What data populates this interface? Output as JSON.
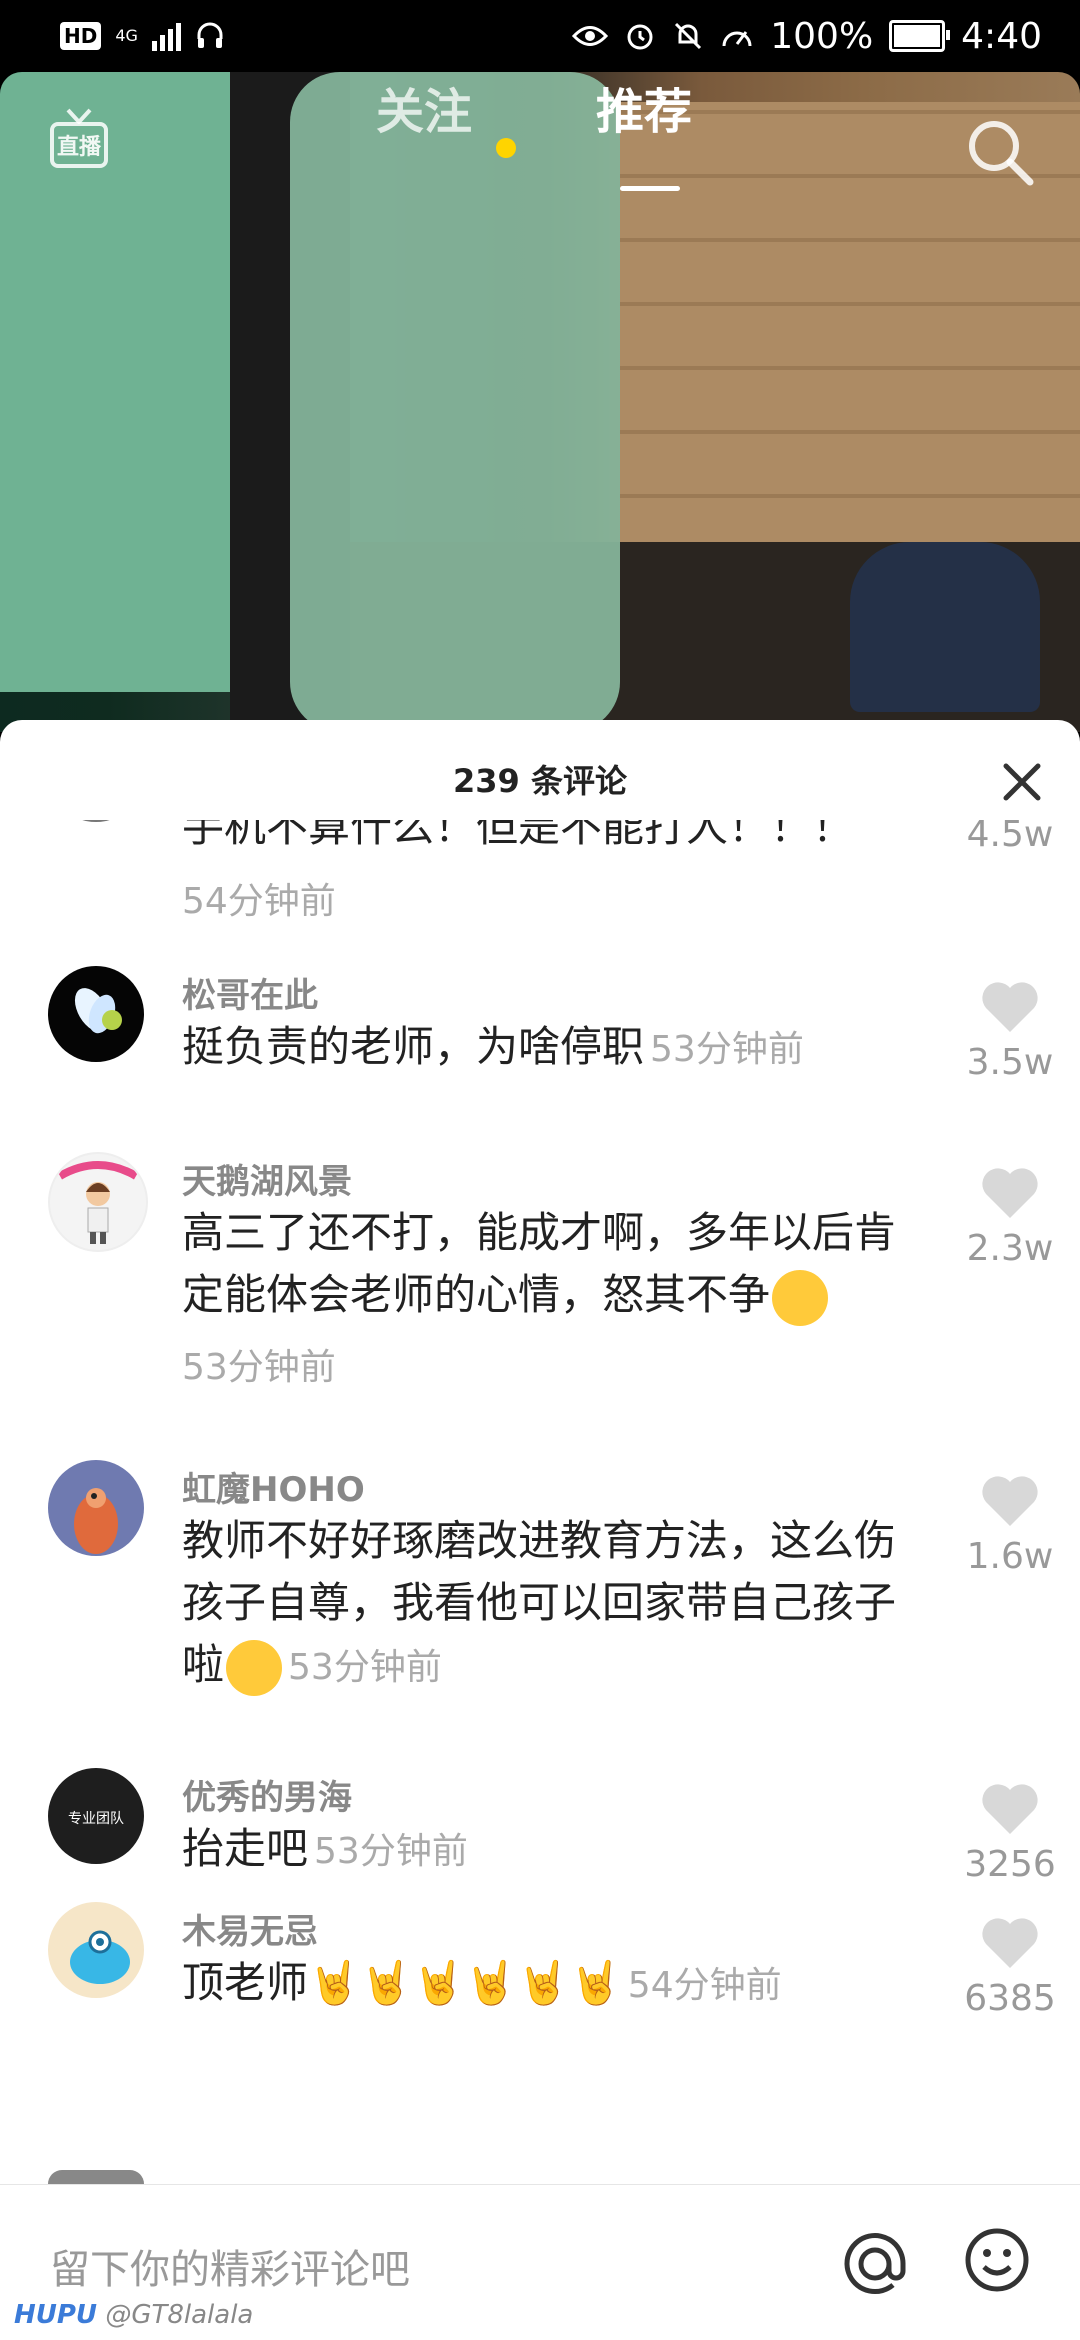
{
  "status_bar": {
    "hd": "HD",
    "network": "4G",
    "battery": "100%",
    "time": "4:40"
  },
  "top_nav": {
    "live_label": "直播",
    "tab_follow": "关注",
    "tab_recommend": "推荐"
  },
  "comments_panel": {
    "title": "239 条评论",
    "comments": [
      {
        "user": "",
        "text": "手机不算什么！但是不能打人！！！",
        "time": "54分钟前",
        "likes": "4.5w"
      },
      {
        "user": "松哥在此",
        "text": "挺负责的老师，为啥停职",
        "time": "53分钟前",
        "likes": "3.5w"
      },
      {
        "user": "天鹅湖风景",
        "text": "高三了还不打，能成才啊，多年以后肯定能体会老师的心情，怒其不争",
        "time": "53分钟前",
        "likes": "2.3w"
      },
      {
        "user": "虹魔HOHO",
        "text": "教师不好好琢磨改进教育方法，这么伤孩子自尊，我看他可以回家带自己孩子啦",
        "time": "53分钟前",
        "likes": "1.6w"
      },
      {
        "user": "优秀的男海",
        "text": "抬走吧",
        "time": "53分钟前",
        "likes": "3256"
      },
      {
        "user": "木易无忌",
        "text": "顶老师",
        "time": "54分钟前",
        "likes": "6385"
      }
    ],
    "avatar_badge_text": "专业团队"
  },
  "input": {
    "placeholder": "留下你的精彩评论吧"
  },
  "watermark": {
    "brand": "HUPU",
    "handle": "@GT8lalala"
  },
  "colors": {
    "accent_dot": "#ffd400",
    "sheet_bg": "#ffffff",
    "muted_text": "#999999"
  }
}
